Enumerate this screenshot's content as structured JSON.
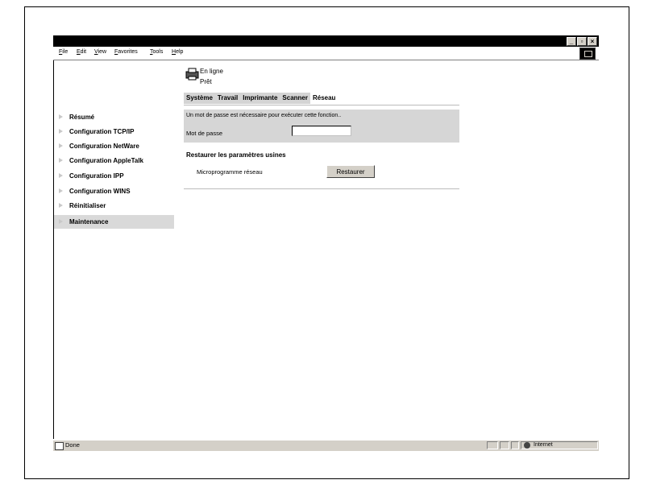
{
  "window": {
    "controls": {
      "minimize": "_",
      "restore": "▫",
      "close": "×"
    }
  },
  "menubar": {
    "items": [
      "File",
      "Edit",
      "View",
      "Favorites",
      "Tools",
      "Help"
    ]
  },
  "printer_status": {
    "line1": "En ligne",
    "line2": "Prêt",
    "icon": "printer-icon"
  },
  "tabs": [
    {
      "label": "Système",
      "active": false
    },
    {
      "label": "Travail",
      "active": false
    },
    {
      "label": "Imprimante",
      "active": false
    },
    {
      "label": "Scanner",
      "active": false
    },
    {
      "label": "Réseau",
      "active": true
    }
  ],
  "sidebar": {
    "items": [
      {
        "label": "Résumé",
        "selected": false
      },
      {
        "label": "Configuration TCP/IP",
        "selected": false
      },
      {
        "label": "Configuration NetWare",
        "selected": false
      },
      {
        "label": "Configuration AppleTalk",
        "selected": false
      },
      {
        "label": "Configuration IPP",
        "selected": false
      },
      {
        "label": "Configuration WINS",
        "selected": false
      },
      {
        "label": "Réinitialiser",
        "selected": false
      },
      {
        "label": "Maintenance",
        "selected": true
      }
    ]
  },
  "password_panel": {
    "message": "Un mot de passe est nécessaire pour exécuter cette fonction..",
    "label": "Mot de passe",
    "value": ""
  },
  "restore_section": {
    "title": "Restaurer les paramètres usines",
    "firmware_label": "Microprogramme réseau",
    "button_label": "Restaurer"
  },
  "statusbar": {
    "text": "Done",
    "zone": "Internet"
  }
}
